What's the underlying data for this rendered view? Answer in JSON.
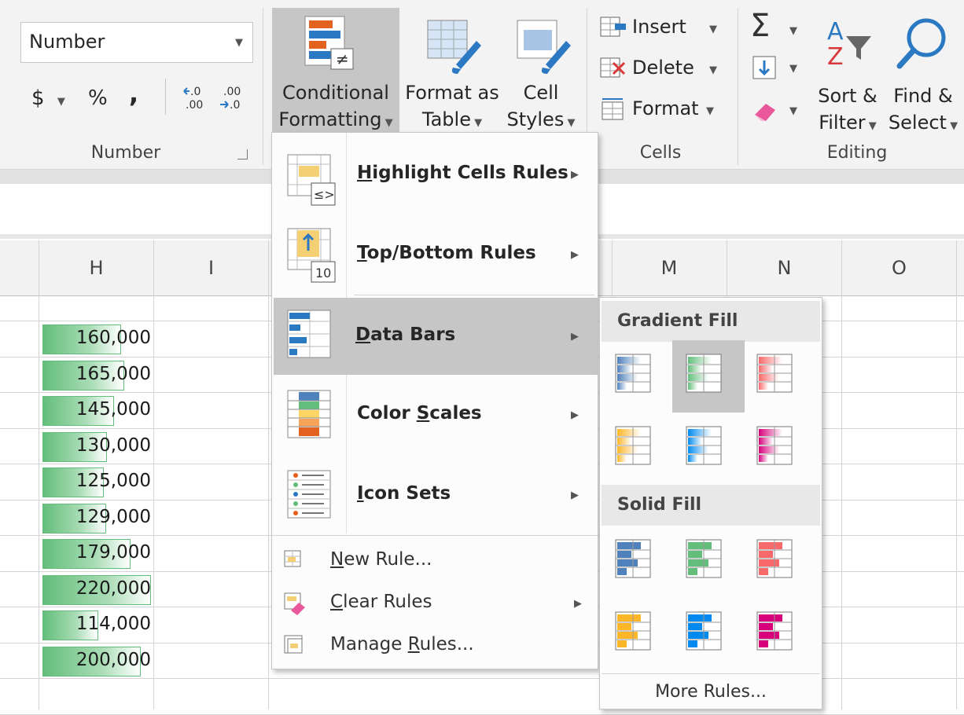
{
  "ribbon": {
    "number_format": "Number",
    "currency_symbol": "$",
    "percent_symbol": "%",
    "comma_symbol": ",",
    "increase_decimal": "←.0\n.00",
    "decrease_decimal": ".00\n→.0",
    "conditional_formatting": [
      "Conditional",
      "Formatting"
    ],
    "format_as_table": [
      "Format as",
      "Table"
    ],
    "cell_styles": [
      "Cell",
      "Styles"
    ],
    "insert_label": "Insert",
    "delete_label": "Delete",
    "format_label": "Format",
    "sum_symbol": "Σ",
    "sort_filter": [
      "Sort &",
      "Filter"
    ],
    "find_select": [
      "Find &",
      "Select"
    ],
    "group_labels": {
      "number": "Number",
      "cells": "Cells",
      "editing": "Editing"
    }
  },
  "grid": {
    "columns": [
      "H",
      "I",
      "M",
      "N",
      "O"
    ],
    "values": [
      "160,000",
      "165,000",
      "145,000",
      "130,000",
      "125,000",
      "129,000",
      "179,000",
      "220,000",
      "114,000",
      "200,000"
    ],
    "bar_fraction": [
      0.727,
      0.75,
      0.659,
      0.591,
      0.568,
      0.586,
      0.814,
      1.0,
      0.518,
      0.909
    ]
  },
  "cf_menu": {
    "items": [
      {
        "label": "Highlight Cells Rules",
        "icon": "highlight-cells-icon"
      },
      {
        "label": "Top/Bottom Rules",
        "icon": "top-bottom-icon"
      },
      {
        "label": "Data Bars",
        "icon": "data-bars-icon"
      },
      {
        "label": "Color Scales",
        "icon": "color-scales-icon"
      },
      {
        "label": "Icon Sets",
        "icon": "icon-sets-icon"
      }
    ],
    "bottom": [
      {
        "label": "New Rule...",
        "icon": "new-rule-icon"
      },
      {
        "label": "Clear Rules",
        "icon": "clear-rules-icon"
      },
      {
        "label": "Manage Rules...",
        "icon": "manage-rules-icon"
      }
    ]
  },
  "data_bars_sub": {
    "gradient_title": "Gradient Fill",
    "solid_title": "Solid Fill",
    "more_rules": "More Rules...",
    "colors": [
      "#4f81bd",
      "#63be7b",
      "#f8696b",
      "#ffb628",
      "#008aef",
      "#d6007b"
    ]
  }
}
